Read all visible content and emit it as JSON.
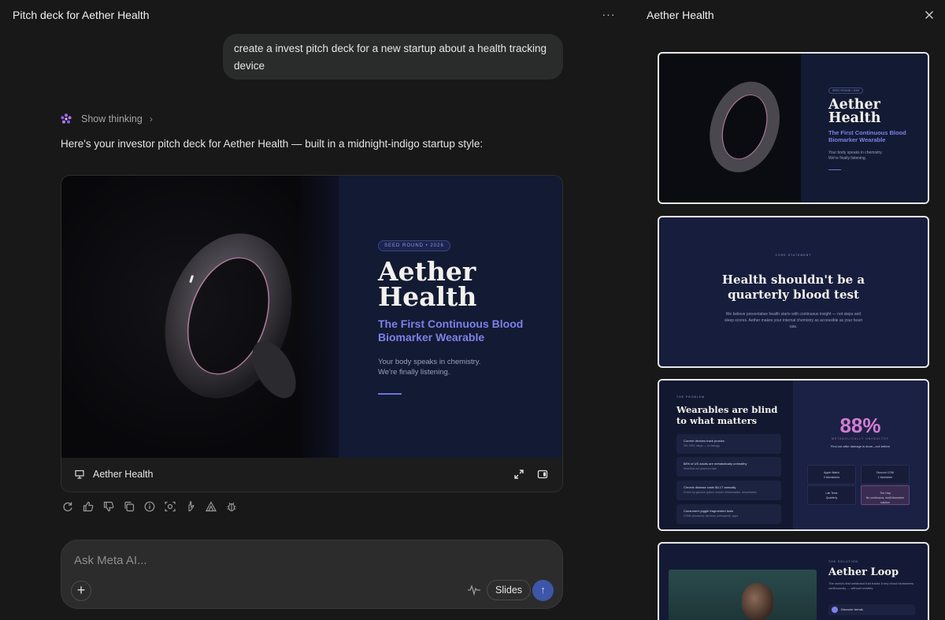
{
  "chat": {
    "title": "Pitch deck for Aether Health",
    "more_label": "···",
    "user_message": "create a invest pitch deck for a new startup about a health tracking device",
    "thinking_label": "Show thinking",
    "reply_text": "Here's your investor pitch deck for Aether Health — built in a midnight-indigo startup style:"
  },
  "deck": {
    "name": "Aether Health",
    "slide1": {
      "badge": "SEED ROUND • 2026",
      "title": "Aether Health",
      "subtitle": "The First Continuous Blood Biomarker Wearable",
      "body_line1": "Your body speaks in chemistry.",
      "body_line2": "We're finally listening."
    }
  },
  "composer": {
    "placeholder": "Ask Meta AI...",
    "slides_chip": "Slides",
    "plus_label": "+",
    "send_label": "↑"
  },
  "side": {
    "title": "Aether Health",
    "slide2": {
      "kicker": "CORE STATEMENT",
      "headline": "Health shouldn't be a quarterly blood test",
      "body": "We believe preventative health starts with continuous insight — not steps and sleep scores. Aether makes your internal chemistry as accessible as your heart rate."
    },
    "slide3": {
      "kicker": "THE PROBLEM",
      "headline": "Wearables are blind to what matters",
      "rows": [
        {
          "title": "Current devices track proxies",
          "detail": "HR, HRV, steps — no biology"
        },
        {
          "title": "88% of US adults are metabolically unhealthy",
          "detail": "Most find out years too late"
        },
        {
          "title": "Chronic disease costs $4.1T annually",
          "detail": "Driven by glucose spikes, insulin, inflammation, dehydration"
        },
        {
          "title": "Consumers juggle fragmented tools",
          "detail": "CGMs (invasive), lab tests (infrequent), apps"
        }
      ],
      "big_stat": "88%",
      "stat_label": "METABOLICALLY UNHEALTHY",
      "stat_caption": "Find out after damage is done—not before",
      "cells": [
        {
          "a": "Apple Watch",
          "b": "0 biomarkers"
        },
        {
          "a": "Dexcom CGM",
          "b": "1 biomarker"
        },
        {
          "a": "Lab Tests",
          "b": "Quarterly"
        },
        {
          "a": "The Gap",
          "b": "No continuous, multi-biomarker solution"
        }
      ]
    },
    "slide4": {
      "kicker": "THE SOLUTION",
      "headline": "Aether Loop",
      "body": "The world's first wristband that tracks 5 key blood biomarkers continuously — without needles.",
      "chip": "Discover trends"
    }
  }
}
